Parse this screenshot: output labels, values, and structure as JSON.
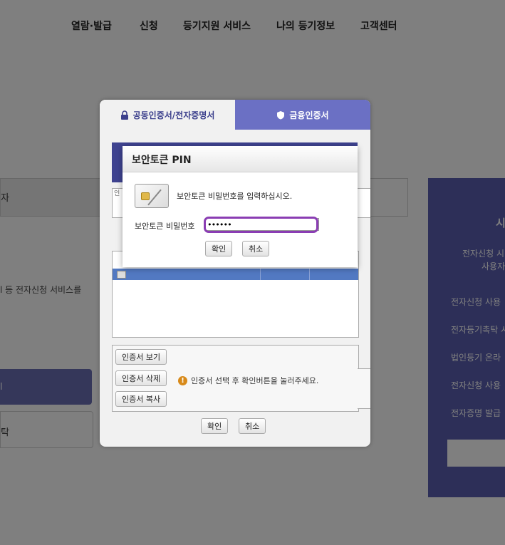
{
  "nav": {
    "items": [
      "열람·발급",
      "신청",
      "등기지원 서비스",
      "나의 등기정보",
      "고객센터"
    ]
  },
  "background": {
    "left_tab_label": "자",
    "left_text": "l 등 전자신청 서비스를",
    "left_button1_label": "l",
    "left_button2_label": "탁",
    "right_panel": {
      "title": "시",
      "lines": [
        "전자신청 시",
        "사용자",
        "전자신청 사용",
        "전자등기촉탁 시",
        "법인등기 온라",
        "전자신청 사용",
        "전자증명 발급"
      ]
    }
  },
  "cert_dialog": {
    "tab_active_label": "공동인증서/전자증명서",
    "tab_inactive_label": "금융인증서",
    "area_label": "인",
    "buttons": {
      "view": "인증서 보기",
      "delete": "인증서 삭제",
      "copy": "인증서 복사",
      "confirm": "확인",
      "cancel": "취소"
    },
    "hint": "인증서 선택 후 확인버튼을 눌러주세요."
  },
  "pin_dialog": {
    "title": "보안토큰 PIN",
    "message": "보안토큰 비밀번호를 입력하십시오.",
    "password_label": "보안토큰 비밀번호",
    "password_value": "••••••",
    "confirm_label": "확인",
    "cancel_label": "취소"
  },
  "colors": {
    "accent": "#6b70c4",
    "highlight": "#8a3db3",
    "selected_row": "#5279c2"
  }
}
